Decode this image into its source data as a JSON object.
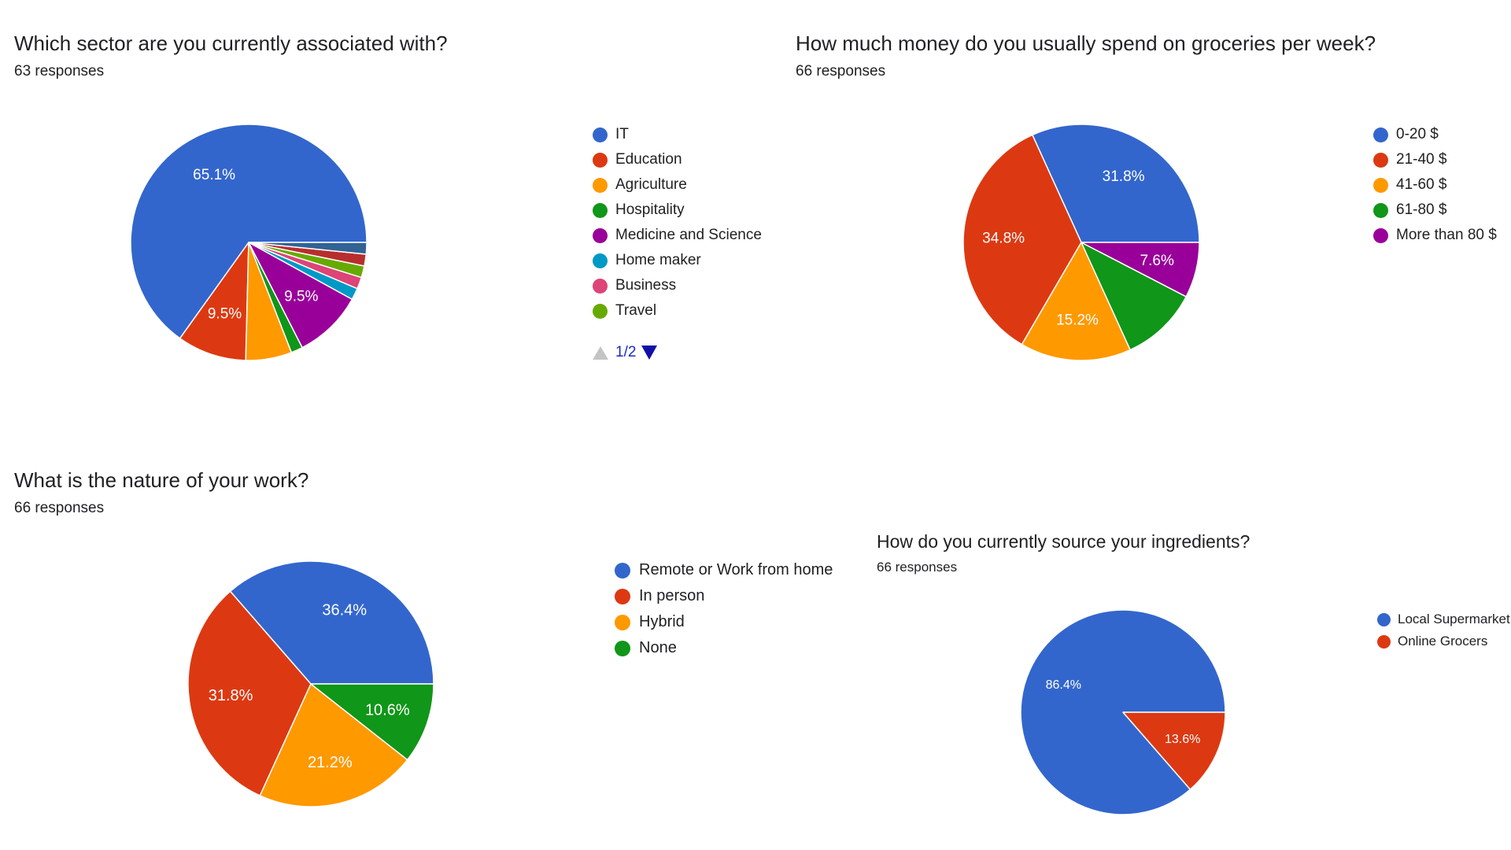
{
  "colors": {
    "blue": "#3366cc",
    "red": "#dc3912",
    "orange": "#ff9900",
    "green": "#109618",
    "purple": "#990099",
    "teal": "#0099c6",
    "pink": "#dd4477",
    "lime": "#66aa00",
    "darkred": "#b82e2e",
    "steel": "#316395"
  },
  "chart_data": [
    {
      "type": "pie",
      "title": "Which sector are you currently associated with?",
      "subtitle": "63 responses",
      "slices": [
        {
          "name": "IT",
          "value": 65.1,
          "label": "65.1%",
          "color": "#3366cc"
        },
        {
          "name": "Education",
          "value": 9.5,
          "label": "9.5%",
          "color": "#dc3912"
        },
        {
          "name": "Agriculture",
          "value": 6.3,
          "label": "",
          "color": "#ff9900"
        },
        {
          "name": "Hospitality",
          "value": 1.6,
          "label": "",
          "color": "#109618"
        },
        {
          "name": "Medicine and Science",
          "value": 9.5,
          "label": "9.5%",
          "color": "#990099"
        },
        {
          "name": "Home maker",
          "value": 1.6,
          "label": "",
          "color": "#0099c6"
        },
        {
          "name": "Business",
          "value": 1.6,
          "label": "",
          "color": "#dd4477"
        },
        {
          "name": "Travel",
          "value": 1.6,
          "label": "",
          "color": "#66aa00"
        },
        {
          "name": "",
          "value": 1.6,
          "label": "",
          "color": "#b82e2e"
        },
        {
          "name": "",
          "value": 1.6,
          "label": "",
          "color": "#316395"
        }
      ],
      "legend": {
        "placement": "right",
        "items": [
          "IT",
          "Education",
          "Agriculture",
          "Hospitality",
          "Medicine and Science",
          "Home maker",
          "Business",
          "Travel"
        ],
        "page": "1/2"
      }
    },
    {
      "type": "pie",
      "title": "How much money do you usually spend on groceries per week?",
      "subtitle": "66 responses",
      "slices": [
        {
          "name": "0-20 $",
          "value": 31.8,
          "label": "31.8%",
          "color": "#3366cc"
        },
        {
          "name": "21-40 $",
          "value": 34.8,
          "label": "34.8%",
          "color": "#dc3912"
        },
        {
          "name": "41-60 $",
          "value": 15.2,
          "label": "15.2%",
          "color": "#ff9900"
        },
        {
          "name": "61-80 $",
          "value": 10.6,
          "label": "",
          "color": "#109618"
        },
        {
          "name": "More than 80 $",
          "value": 7.6,
          "label": "7.6%",
          "color": "#990099"
        }
      ],
      "legend": {
        "placement": "right",
        "items": [
          "0-20 $",
          "21-40 $",
          "41-60 $",
          "61-80 $",
          "More than 80 $"
        ]
      }
    },
    {
      "type": "pie",
      "title": "What is the nature of your work?",
      "subtitle": "66 responses",
      "slices": [
        {
          "name": "Remote or Work from home",
          "value": 36.4,
          "label": "36.4%",
          "color": "#3366cc"
        },
        {
          "name": "In person",
          "value": 31.8,
          "label": "31.8%",
          "color": "#dc3912"
        },
        {
          "name": "Hybrid",
          "value": 21.2,
          "label": "21.2%",
          "color": "#ff9900"
        },
        {
          "name": "None",
          "value": 10.6,
          "label": "10.6%",
          "color": "#109618"
        }
      ],
      "legend": {
        "placement": "right",
        "items": [
          "Remote or Work from home",
          "In person",
          "Hybrid",
          "None"
        ]
      }
    },
    {
      "type": "pie",
      "title": "How do you currently source your ingredients?",
      "subtitle": "66 responses",
      "slices": [
        {
          "name": "Local Supermarket",
          "value": 86.4,
          "label": "86.4%",
          "color": "#3366cc"
        },
        {
          "name": "Online Grocers",
          "value": 13.6,
          "label": "13.6%",
          "color": "#dc3912"
        }
      ],
      "legend": {
        "placement": "right",
        "items": [
          "Local Supermarket",
          "Online Grocers"
        ]
      }
    }
  ]
}
